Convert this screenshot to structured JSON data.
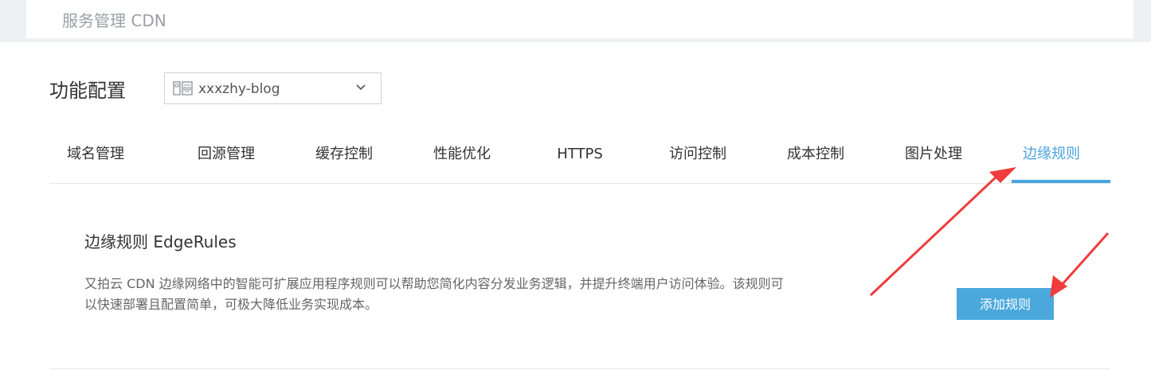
{
  "header": {
    "title": "服务管理 CDN"
  },
  "config": {
    "section_title": "功能配置",
    "domain_select": {
      "value": "xxxzhy-blog",
      "icon": "site-icon"
    }
  },
  "tabs": [
    {
      "label": "域名管理",
      "active": false
    },
    {
      "label": "回源管理",
      "active": false
    },
    {
      "label": "缓存控制",
      "active": false
    },
    {
      "label": "性能优化",
      "active": false
    },
    {
      "label": "HTTPS",
      "active": false
    },
    {
      "label": "访问控制",
      "active": false
    },
    {
      "label": "成本控制",
      "active": false
    },
    {
      "label": "图片处理",
      "active": false
    },
    {
      "label": "边缘规则",
      "active": true
    }
  ],
  "panel": {
    "title": "边缘规则 EdgeRules",
    "description": "又拍云 CDN 边缘网络中的智能可扩展应用程序规则可以帮助您简化内容分发业务逻辑，并提升终端用户访问体验。该规则可以快速部署且配置简单，可极大降低业务实现成本。",
    "add_button": "添加规则"
  },
  "colors": {
    "accent": "#4aa3df",
    "button": "#4aa8dc",
    "annotation_arrow": "#f03c3c"
  }
}
